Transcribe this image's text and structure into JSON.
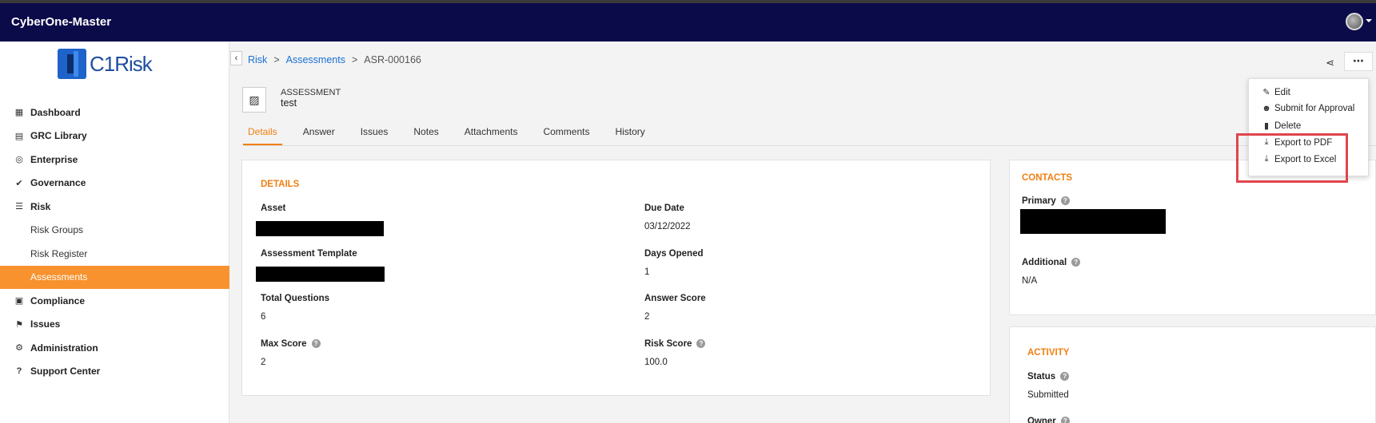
{
  "app": {
    "name": "CyberOne-Master"
  },
  "logo": {
    "text": "C1Risk"
  },
  "sidebar": {
    "items": [
      {
        "label": "Dashboard",
        "icon": "dashboard-icon"
      },
      {
        "label": "GRC Library",
        "icon": "book-icon"
      },
      {
        "label": "Enterprise",
        "icon": "globe-icon"
      },
      {
        "label": "Governance",
        "icon": "double-check-icon"
      },
      {
        "label": "Risk",
        "icon": "list-icon"
      },
      {
        "label": "Risk Groups"
      },
      {
        "label": "Risk Register"
      },
      {
        "label": "Assessments",
        "active": true
      },
      {
        "label": "Compliance",
        "icon": "clipboard-check-icon"
      },
      {
        "label": "Issues",
        "icon": "flag-icon"
      },
      {
        "label": "Administration",
        "icon": "gear-icon"
      },
      {
        "label": "Support Center",
        "icon": "question-circle-icon"
      }
    ]
  },
  "breadcrumb": {
    "items": [
      "Risk",
      "Assessments",
      "ASR-000166"
    ],
    "separator": ">"
  },
  "record": {
    "type": "ASSESSMENT",
    "name": "test"
  },
  "tabs": [
    "Details",
    "Answer",
    "Issues",
    "Notes",
    "Attachments",
    "Comments",
    "History"
  ],
  "details": {
    "title": "DETAILS",
    "fields": {
      "asset": {
        "label": "Asset",
        "value": ""
      },
      "due_date": {
        "label": "Due Date",
        "value": "03/12/2022"
      },
      "assessment_template": {
        "label": "Assessment Template",
        "value": ""
      },
      "days_opened": {
        "label": "Days Opened",
        "value": "1"
      },
      "total_questions": {
        "label": "Total Questions",
        "value": "6"
      },
      "answer_score": {
        "label": "Answer Score",
        "value": "2"
      },
      "max_score": {
        "label": "Max Score",
        "value": "2"
      },
      "risk_score": {
        "label": "Risk Score",
        "value": "100.0"
      }
    }
  },
  "contacts": {
    "title": "CONTACTS",
    "primary": {
      "label": "Primary",
      "value": ""
    },
    "additional": {
      "label": "Additional",
      "value": "N/A"
    }
  },
  "activity": {
    "title": "ACTIVITY",
    "status": {
      "label": "Status",
      "value": "Submitted"
    },
    "owner": {
      "label": "Owner"
    }
  },
  "actions_menu": {
    "items": [
      {
        "label": "Edit",
        "icon": "edit-icon"
      },
      {
        "label": "Submit for Approval",
        "icon": "users-icon"
      },
      {
        "label": "Delete",
        "icon": "trash-icon"
      },
      {
        "label": "Export to PDF",
        "icon": "download-icon"
      },
      {
        "label": "Export to Excel",
        "icon": "download-icon"
      }
    ]
  },
  "colors": {
    "topbar": "#0b0b4a",
    "accent": "#f7922e",
    "link": "#1a6fd6",
    "highlight": "#e0454c"
  }
}
